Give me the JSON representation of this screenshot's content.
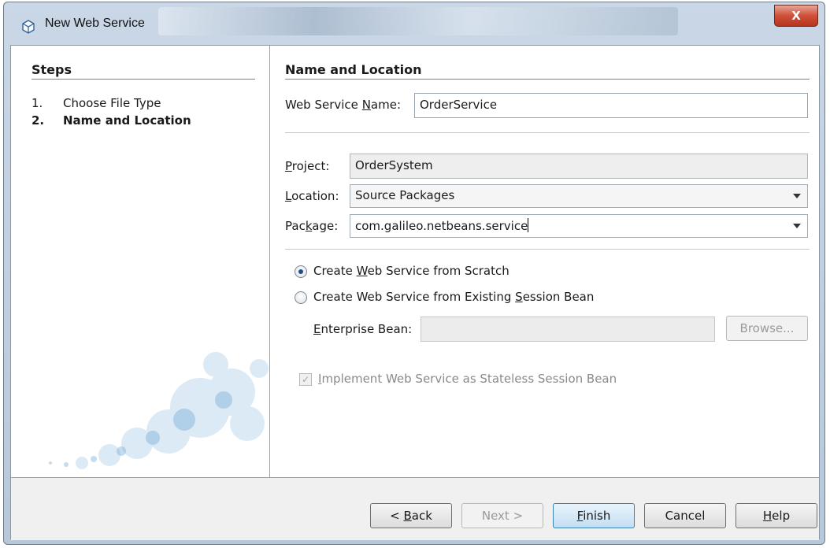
{
  "window": {
    "title": "New Web Service",
    "icon": "netbeans-cube-icon",
    "close_glyph": "X"
  },
  "steps": {
    "title": "Steps",
    "items": [
      {
        "number": "1.",
        "label": "Choose File Type",
        "current": false
      },
      {
        "number": "2.",
        "label": "Name and Location",
        "current": true
      }
    ]
  },
  "panel": {
    "title": "Name and Location",
    "web_service_name": {
      "label_pre": "Web Service ",
      "label_mnemonic": "N",
      "label_post": "ame:",
      "value": "OrderService"
    },
    "project": {
      "label_mnemonic": "P",
      "label_post": "roject:",
      "value": "OrderSystem"
    },
    "location": {
      "label_mnemonic": "L",
      "label_post": "ocation:",
      "value": "Source Packages"
    },
    "package": {
      "label_pre": "Pac",
      "label_mnemonic": "k",
      "label_post": "age:",
      "value": "com.galileo.netbeans.service"
    },
    "radio_scratch": {
      "label_pre": "Create ",
      "label_mnemonic": "W",
      "label_post": "eb Service from Scratch",
      "selected": true
    },
    "radio_existing": {
      "label_pre": "Create Web Service from Existing ",
      "label_mnemonic": "S",
      "label_post": "ession Bean",
      "selected": false
    },
    "enterprise_bean": {
      "label_mnemonic": "E",
      "label_post": "nterprise Bean:",
      "value": ""
    },
    "browse_label": "Browse...",
    "stateless_checkbox": {
      "label_mnemonic": "I",
      "label_post": "mplement Web Service as Stateless Session Bean",
      "checked": true,
      "enabled": false
    }
  },
  "footer": {
    "back": {
      "pre": "< ",
      "mnemonic": "B",
      "post": "ack"
    },
    "next": "Next >",
    "finish": {
      "mnemonic": "F",
      "post": "inish"
    },
    "cancel": "Cancel",
    "help": {
      "mnemonic": "H",
      "post": "elp"
    }
  },
  "colors": {
    "accent": "#1f4f86",
    "close_red": "#cf4f38",
    "default_button": "#c3def2"
  }
}
